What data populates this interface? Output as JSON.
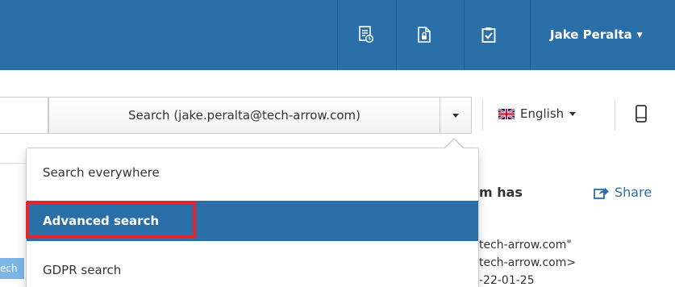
{
  "navbar": {
    "background": "#2a6fa8",
    "icons": [
      "report-schedule-icon",
      "locked-document-icon",
      "task-checklist-icon"
    ],
    "user_name": "Jake Peralta"
  },
  "toolbar": {
    "search_label": "Search (jake.peralta@tech-arrow.com)",
    "language_label": "English",
    "mobile_icon": "mobile-phone-icon"
  },
  "dropdown": {
    "items": [
      {
        "label": "Search everywhere",
        "active": false
      },
      {
        "label": "Advanced search",
        "active": true
      },
      {
        "label": "GDPR search",
        "active": false
      }
    ],
    "highlight_color": "#e3262d"
  },
  "content": {
    "title_fragment": "m has",
    "share_label": "Share",
    "line1": "tech-arrow.com\"",
    "line2": "tech-arrow.com>",
    "line3": "-22-01-25",
    "left_fragment": "ech"
  }
}
